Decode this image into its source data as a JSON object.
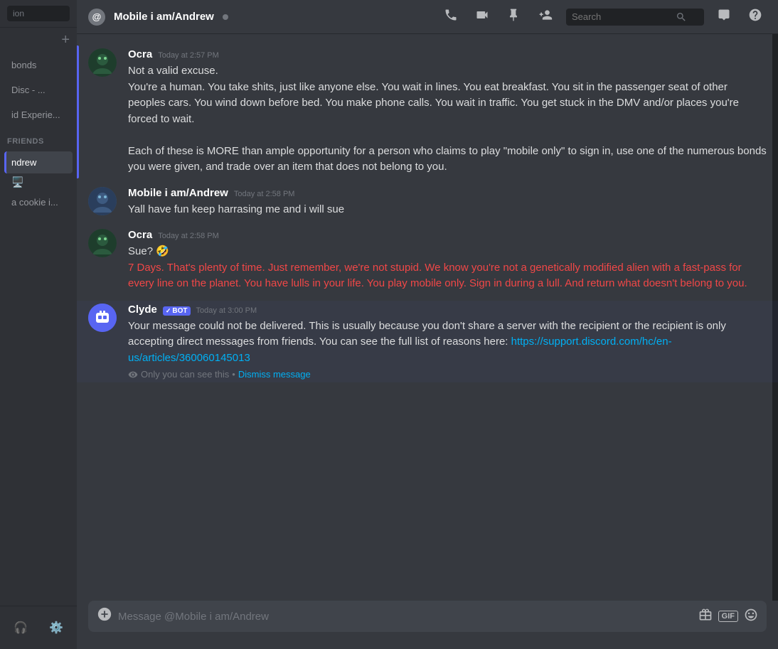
{
  "sidebar": {
    "search_placeholder": "ion",
    "plus_label": "+",
    "items": [
      {
        "id": "bonds",
        "label": "bonds",
        "active": false
      },
      {
        "id": "disc",
        "label": "Disc - ...",
        "active": false
      },
      {
        "id": "id-experie",
        "label": "id Experie...",
        "active": false
      }
    ],
    "friends_label": "Friends",
    "bottom_items": [
      {
        "id": "andrew",
        "label": "ndrew",
        "active": true
      },
      {
        "id": "cookie",
        "label": "a cookie i...",
        "active": false
      }
    ],
    "icons": {
      "headset": "🎧",
      "settings": "⚙️",
      "monitor": "🖥️"
    }
  },
  "header": {
    "channel_icon": "@",
    "title": "Mobile i am/Andrew",
    "status": "online",
    "icons": {
      "call": "📞",
      "video": "📹",
      "pin": "📌",
      "add_friend": "➕"
    },
    "search_placeholder": "Search",
    "inbox_icon": "📥",
    "help_icon": "❓"
  },
  "messages": [
    {
      "id": "msg1",
      "author": "Ocra",
      "author_class": "ocra",
      "timestamp": "Today at 2:57 PM",
      "segments": [
        {
          "type": "text",
          "text": "Not a valid excuse.\nYou're a human. You take shits, just like anyone else. You wait in lines. You eat breakfast. You sit in the passenger seat of other peoples cars. You wind down before bed. You make phone calls. You wait in traffic. You get stuck in the DMV and/or places you're forced to wait.\n\nEach of these is MORE than ample opportunity for a person who claims to play \"mobile only\" to sign in, use one of the numerous bonds you were given, and trade over an item that does not belong to you."
        }
      ]
    },
    {
      "id": "msg2",
      "author": "Mobile i am/Andrew",
      "author_class": "andrew",
      "timestamp": "Today at 2:58 PM",
      "segments": [
        {
          "type": "text",
          "text": "Yall have fun keep harrasing me and i will sue"
        }
      ]
    },
    {
      "id": "msg3",
      "author": "Ocra",
      "author_class": "ocra",
      "timestamp": "Today at 2:58 PM",
      "segments": [
        {
          "type": "text",
          "text": "Sue? 🤣"
        },
        {
          "type": "red",
          "text": "7 Days. That's plenty of time.\nJust remember, we're not stupid. We know you're not a genetically modified alien with a fast-pass for every line on the planet. You have lulls in your life. You play mobile only.\n\nSign in during a lull. And return what doesn't belong to you."
        }
      ]
    },
    {
      "id": "msg4",
      "author": "Clyde",
      "author_class": "clyde",
      "is_bot": true,
      "timestamp": "Today at 3:00 PM",
      "segments": [
        {
          "type": "text",
          "text": "Your message could not be delivered. This is usually because you don't share a server with the recipient or the recipient is only accepting direct messages from friends. You can see the full list of reasons here: "
        },
        {
          "type": "link",
          "text": "https://support.discord.com/hc/en-us/articles/360060145013",
          "href": "https://support.discord.com/hc/en-us/articles/360060145013"
        }
      ],
      "system_note": "Only you can see this",
      "dismiss_label": "Dismiss message"
    }
  ],
  "input": {
    "placeholder": "Message @Mobile i am/Andrew"
  },
  "scroll_bar": {
    "active": true
  }
}
